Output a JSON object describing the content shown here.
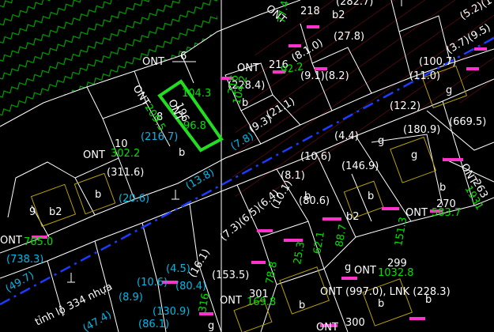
{
  "colors": {
    "background": "#000000",
    "parcel_line": "#ffffff",
    "hatch_green": "#00b000",
    "hatch_red": "#8a1010",
    "road_centerline": "#1a3cff",
    "selection_highlight": "#22dd22",
    "area_text": "#00e000",
    "road_width_text": "#00b8e6",
    "label_text": "#ffffff",
    "marker": "#ff33cc",
    "building_outline": "#b8a000"
  },
  "selected_parcel": {
    "label": "ONT",
    "number": "196",
    "area": "96.8",
    "side_length": "104.3"
  },
  "parcels": [
    {
      "code": "ONT",
      "number": "6"
    },
    {
      "code": "ONT",
      "number": "216",
      "area_paren": "(228.4)"
    },
    {
      "code": "ONT",
      "number": "8",
      "area": "209.5",
      "area_paren": "(216.7)"
    },
    {
      "code": "ONT",
      "number": "10",
      "area": "302.2",
      "area_paren": "(311.6)"
    },
    {
      "code": "ONT",
      "number": "9",
      "area": "765.0",
      "area_paren": "(738.3)"
    },
    {
      "code": "ONT",
      "number": "270",
      "area": "583.7"
    },
    {
      "code": "ONT",
      "number": "299",
      "area": "1032.8"
    },
    {
      "code": "ONT",
      "number": "301",
      "area": "169.8"
    },
    {
      "code": "ONT",
      "number": "300"
    },
    {
      "code": "ONT",
      "number": "218"
    },
    {
      "code": "ONT",
      "number": "263",
      "area": "1931"
    }
  ],
  "labels": {
    "road_name": "tỉnh lộ 334 nhựa",
    "mixed_label": "ONT (997.0), LNK (228.3)",
    "b": "b",
    "b2": "b2",
    "g": "g"
  },
  "dimensions": {
    "d_282_7": "(282.7)",
    "d_27_8": "(27.8)",
    "d_8_1_0": "(8.1.0)",
    "d_9_1_8_2": "(9.1)(8.2)",
    "d_11_0": "(11.0)",
    "d_5_2_1": "(5.2)(1",
    "d_3_7_9_5": "(3.7)(9.5)",
    "d_100_7": "(100.7)",
    "d_12_2": "(12.2)",
    "d_180_9": "(180.9)",
    "d_669_5": "(669.5)",
    "d_4_4": "(4.4)",
    "d_10_6a": "(10.6)",
    "d_146_9": "(146.9)",
    "d_8_1": "(8.1)",
    "d_80_6": "(80.6)",
    "d_13_8": "(13.8)",
    "d_7_8": "(7.8)",
    "d_20_6": "(20.6)",
    "d_49_7": "(49.7)",
    "d_4_5": "(4.5)",
    "d_10_6b": "(10.6)",
    "d_80_4": "(80.4)",
    "d_8_9": "(8.9)",
    "d_153_5": "(153.5)",
    "d_130_9": "(130.9)",
    "d_16_1": "(16.1)",
    "d_47_4": "(47.4)",
    "d_86_1": "(86.1)",
    "d_21_1": "(21.1)",
    "d_9_3": "(9.3)",
    "d_7_3": "(7.3)(6.5)(6.4)",
    "d_10_1": "(10.1)"
  },
  "areas": {
    "a_151_3": "151.3",
    "a_88_7": "88.7",
    "a_62_1": "62.1",
    "a_78_8": "78.8",
    "a_316": "316",
    "a_104_2": "104.2",
    "a_77_4": "77.4",
    "a_25_3": "25.3",
    "a_92_2": "92.2",
    "a_96_9": "96.9",
    "a_98_1": "98.1",
    "a_216": "216"
  }
}
